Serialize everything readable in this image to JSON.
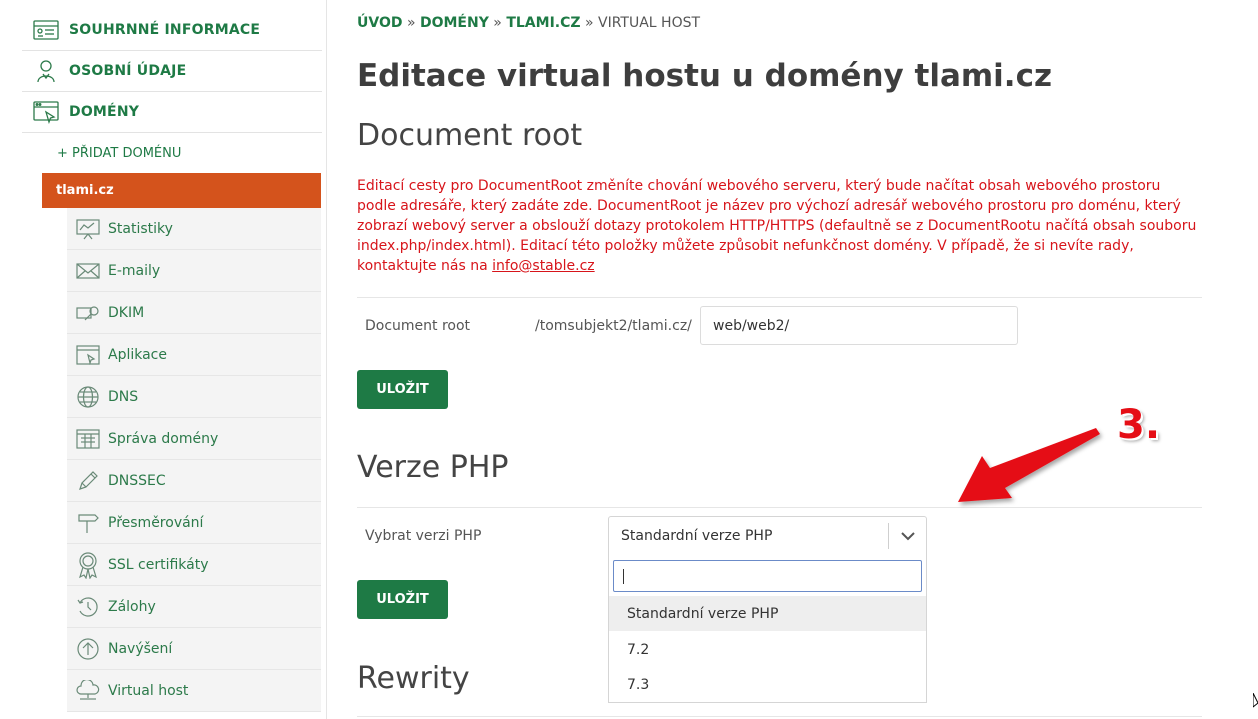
{
  "sidebar": {
    "top_items": [
      {
        "label": "SOUHRNNÉ INFORMACE",
        "icon": "summary-icon"
      },
      {
        "label": "OSOBNÍ ÚDAJE",
        "icon": "person-icon"
      },
      {
        "label": "DOMÉNY",
        "icon": "domains-icon"
      }
    ],
    "add_domain": "+ PŘIDAT DOMÉNU",
    "active_domain": "tlami.cz",
    "sub_items": [
      {
        "label": "Statistiky",
        "icon": "statistics-icon"
      },
      {
        "label": "E-maily",
        "icon": "email-icon"
      },
      {
        "label": "DKIM",
        "icon": "key-icon"
      },
      {
        "label": "Aplikace",
        "icon": "application-icon"
      },
      {
        "label": "DNS",
        "icon": "globe-icon"
      },
      {
        "label": "Správa domény",
        "icon": "domain-management-icon"
      },
      {
        "label": "DNSSEC",
        "icon": "pen-icon"
      },
      {
        "label": "Přesměrování",
        "icon": "signpost-icon"
      },
      {
        "label": "SSL certifikáty",
        "icon": "ssl-badge-icon"
      },
      {
        "label": "Zálohy",
        "icon": "backup-clock-icon"
      },
      {
        "label": "Navýšení",
        "icon": "arrow-up-circle-icon"
      },
      {
        "label": "Virtual host",
        "icon": "cloud-icon"
      }
    ]
  },
  "breadcrumb": {
    "home": "ÚVOD",
    "sep": "»",
    "domains": "DOMÉNY",
    "domain": "TLAMI.CZ",
    "current": "VIRTUAL HOST"
  },
  "page_title": "Editace virtual hostu u domény tlami.cz",
  "doc_root": {
    "heading": "Document root",
    "warning_text": "Editací cesty pro DocumentRoot změníte chování webového serveru, který bude načítat obsah webového prostoru podle adresáře, který zadáte zde. DocumentRoot je název pro výchozí adresář webového prostoru pro doménu, který zobrazí webový server a obslouží dotazy protokolem HTTP/HTTPS (defaultně se z DocumentRootu načítá obsah souboru index.php/index.html). Editací této položky můžete způsobit nefunkčnost domény. V případě, že si nevíte rady, kontaktujte nás na ",
    "warning_link": "info@stable.cz",
    "label": "Document root",
    "prefix": "/tomsubjekt2/tlami.cz/",
    "value": "web/web2/",
    "save": "ULOŽIT"
  },
  "php": {
    "heading": "Verze PHP",
    "label": "Vybrat verzi PHP",
    "selected": "Standardní verze PHP",
    "search_value": "",
    "options": [
      "Standardní verze PHP",
      "7.2",
      "7.3"
    ],
    "save": "ULOŽIT"
  },
  "rewrites": {
    "heading": "Rewrity"
  },
  "annotation": {
    "label": "3.",
    "color": "#e50e16"
  },
  "colors": {
    "brand": "#1e7a45",
    "active": "#d4531c",
    "warning": "#d7141a"
  }
}
